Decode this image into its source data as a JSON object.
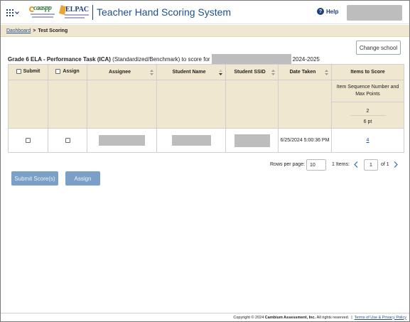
{
  "header": {
    "app_title": "Teacher Hand Scoring System",
    "help_label": "Help",
    "logo_caaspp": "caaspp",
    "logo_elpac": "ELPAC",
    "accent_color": "#1f3f78"
  },
  "breadcrumb": {
    "home": "Dashboard",
    "separator": ">",
    "current": "Test Scoring"
  },
  "change_school_label": "Change school",
  "task": {
    "name": "Grade 6 ELA - Performance Task (ICA)",
    "type": "(Standardized/Benchmark) to score for",
    "year": "2024-2025"
  },
  "table": {
    "columns": {
      "submit": "Submit",
      "assign": "Assign",
      "assignee": "Assignee",
      "student_name": "Student Name",
      "student_ssid": "Student SSID",
      "date_taken": "Date Taken",
      "items_to_score": "Items to Score"
    },
    "items_subheader": "Item Sequence Number and Max Points",
    "item_sequence": "2",
    "item_max_points": "6 pt",
    "rows": [
      {
        "date_taken": "6/25/2024 5:00:36 PM",
        "items_link": "4"
      }
    ]
  },
  "pagination": {
    "rows_per_page_label": "Rows per page:",
    "rows_per_page_value": "10",
    "items_count": "1 Items:",
    "current_page": "1",
    "of_label": "of 1"
  },
  "buttons": {
    "submit_scores": "Submit Score(s)",
    "assign": "Assign"
  },
  "footer": {
    "copyright_prefix": "Copyright © 2024",
    "company": "Cambium Assessment, Inc.",
    "rights": "All rights reserved.",
    "separator": "|",
    "terms_link": "Terms of Use & Privacy Policy"
  }
}
